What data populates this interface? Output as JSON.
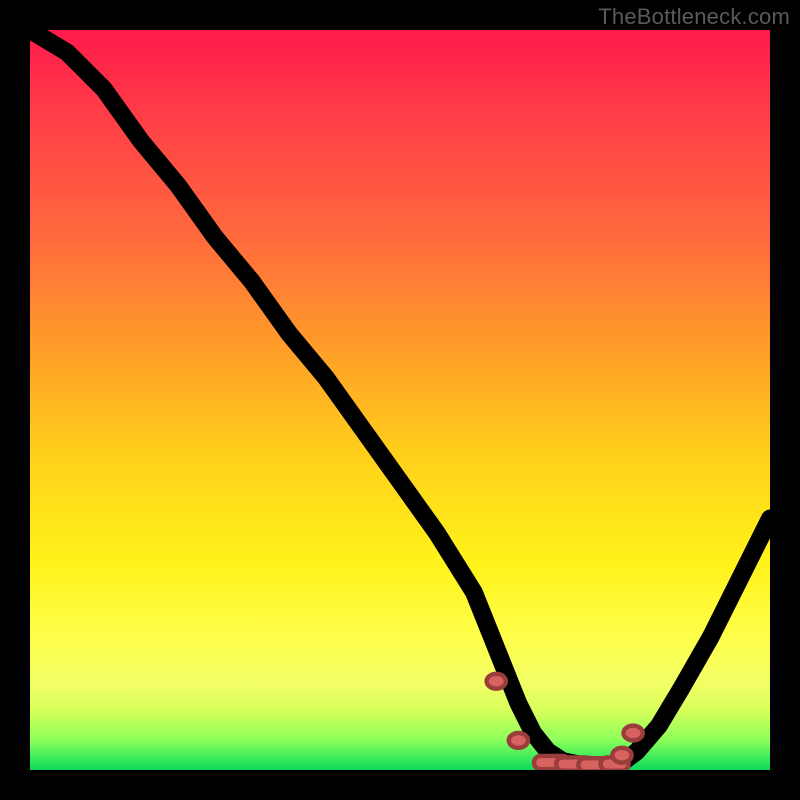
{
  "watermark": "TheBottleneck.com",
  "chart_data": {
    "type": "line",
    "title": "",
    "xlabel": "",
    "ylabel": "",
    "xlim": [
      0,
      100
    ],
    "ylim": [
      0,
      100
    ],
    "grid": false,
    "legend": false,
    "series": [
      {
        "name": "bottleneck-curve",
        "x": [
          0,
          5,
          10,
          15,
          20,
          25,
          30,
          35,
          40,
          45,
          50,
          55,
          60,
          62,
          64,
          66,
          68,
          70,
          72,
          74,
          76,
          78,
          80,
          82,
          85,
          88,
          92,
          96,
          100
        ],
        "values": [
          100,
          97,
          92,
          85,
          79,
          72,
          66,
          59,
          53,
          46,
          39,
          32,
          24,
          19,
          14,
          9,
          5,
          2.5,
          1.2,
          0.8,
          0.7,
          0.7,
          1,
          2.5,
          6,
          11,
          18,
          26,
          34
        ]
      }
    ],
    "optimal_zone": {
      "x_start": 63,
      "x_end": 80,
      "y": 1
    },
    "markers": [
      {
        "x": 63,
        "y": 12
      },
      {
        "x": 66,
        "y": 4
      },
      {
        "x": 69,
        "y": 1
      },
      {
        "x": 72,
        "y": 0.8
      },
      {
        "x": 75,
        "y": 0.7
      },
      {
        "x": 78,
        "y": 0.8
      },
      {
        "x": 80,
        "y": 2
      },
      {
        "x": 81.5,
        "y": 5
      }
    ],
    "gradient_stops": [
      {
        "pct": 0,
        "color": "#ff1a4b"
      },
      {
        "pct": 28,
        "color": "#ff6a3d"
      },
      {
        "pct": 58,
        "color": "#ffd21a"
      },
      {
        "pct": 82,
        "color": "#ffff4a"
      },
      {
        "pct": 96,
        "color": "#8aff5a"
      },
      {
        "pct": 100,
        "color": "#14d65a"
      }
    ]
  }
}
